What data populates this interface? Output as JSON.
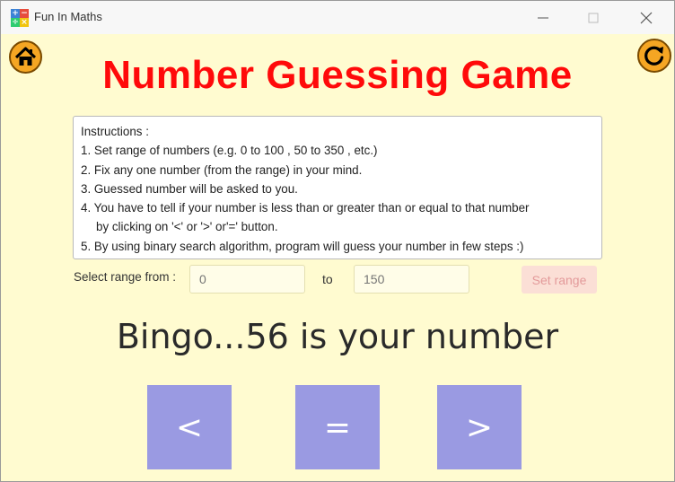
{
  "window": {
    "title": "Fun In Maths",
    "app_icon_glyphs": [
      "+",
      "−",
      "÷",
      "×"
    ],
    "controls": [
      "minimize",
      "maximize",
      "close"
    ]
  },
  "toolbar": {
    "home_icon": "home-icon",
    "refresh_icon": "refresh-icon"
  },
  "game": {
    "title": "Number Guessing Game",
    "title_color": "#ff0a0a"
  },
  "instructions": {
    "lines": [
      "Instructions :",
      "1. Set range of numbers (e.g. 0 to 100 , 50 to 350 , etc.)",
      "2. Fix any one number (from the range) in your mind.",
      "3. Guessed number will be asked to you.",
      "4. You have to tell if your number is less than or greater than or equal to that number",
      "by clicking on '<' or '>' or'=' button.",
      "5. By using binary search algorithm, program will guess your number in few steps :)"
    ]
  },
  "range": {
    "label": "Select range from :",
    "from_placeholder": "0",
    "to_label": "to",
    "to_placeholder": "150",
    "set_button": "Set range"
  },
  "result": {
    "text": "Bingo...56 is your number"
  },
  "buttons": {
    "less": "<",
    "equal": "=",
    "greater": ">"
  },
  "colors": {
    "background": "#fffbd0",
    "button": "#9a9ae2",
    "accent": "#f5a623"
  }
}
